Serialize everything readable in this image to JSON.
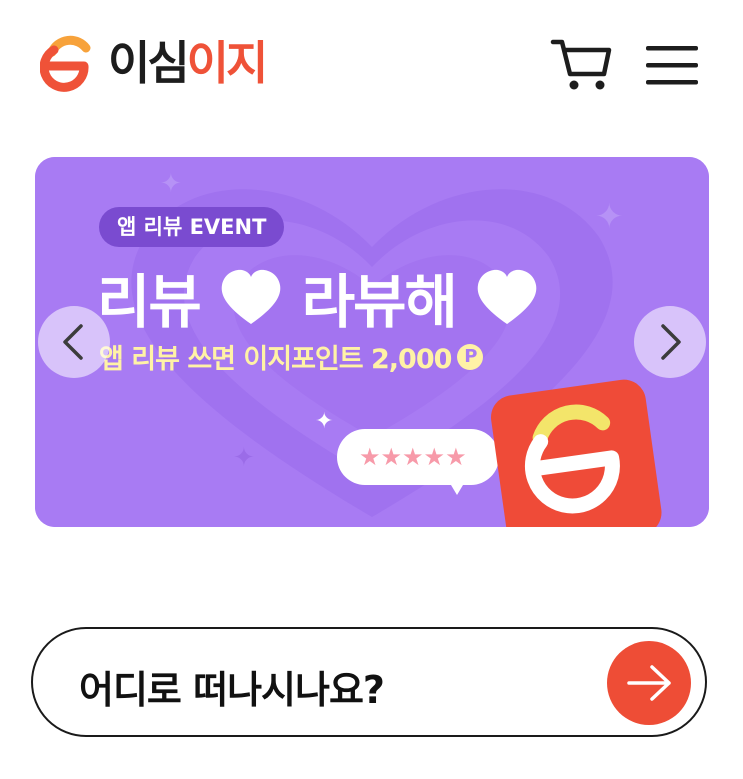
{
  "header": {
    "logo_dark": "이심",
    "logo_accent": "이지",
    "cart_icon": "cart-icon",
    "menu_icon": "hamburger-menu-icon"
  },
  "banner": {
    "tag": "앱 리뷰 EVENT",
    "headline_part1": "리뷰",
    "headline_part2": "라뷰해",
    "subline": "앱 리뷰 쓰면 이지포인트 2,000",
    "point_symbol": "P",
    "rating_stars": "★★★★★",
    "prev_icon": "chevron-left-icon",
    "next_icon": "chevron-right-icon"
  },
  "search": {
    "placeholder": "어디로 떠나시나요?",
    "go_icon": "arrow-right-icon"
  },
  "colors": {
    "brand_orange": "#ef5238",
    "banner_purple": "#a87bf3",
    "tag_purple": "#7a4bd0",
    "subline_yellow": "#fff2a6",
    "star_pink": "#f79aa9"
  }
}
